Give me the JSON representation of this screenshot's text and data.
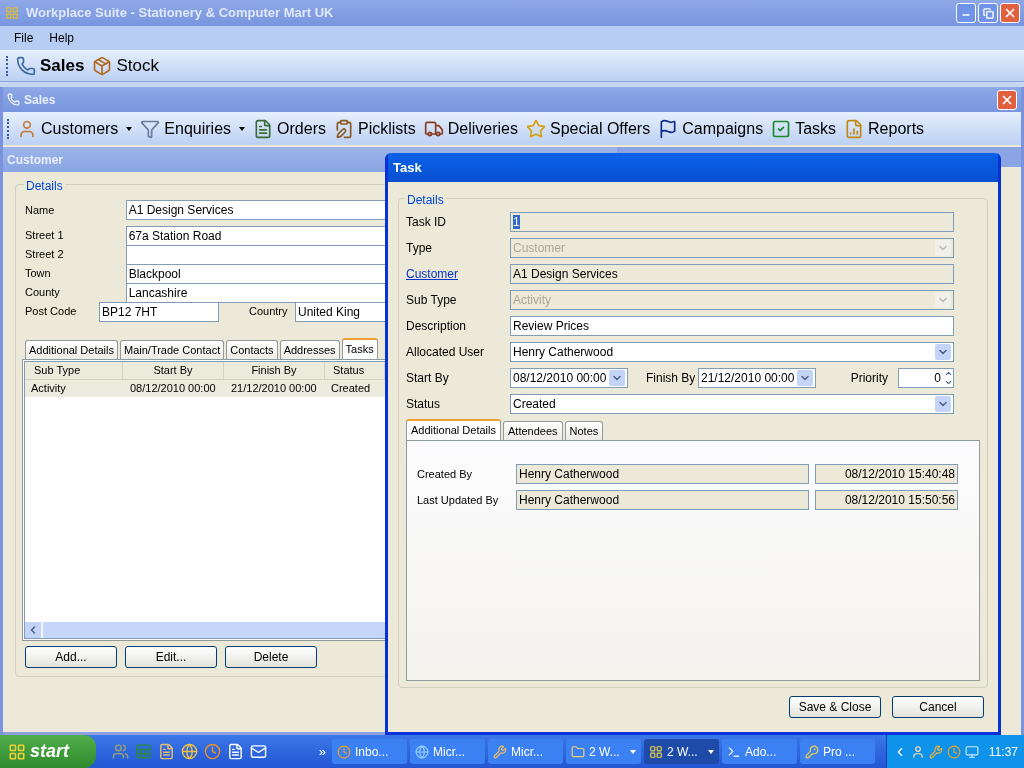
{
  "window": {
    "title": "Workplace Suite - Stationery & Computer Mart UK"
  },
  "menu": [
    {
      "label": "File"
    },
    {
      "label": "Help"
    }
  ],
  "modules": [
    {
      "label": "Sales",
      "selected": true
    },
    {
      "label": "Stock",
      "selected": false
    }
  ],
  "sales_window": {
    "title": "Sales",
    "toolbar": [
      {
        "label": "Customers",
        "dropdown": true
      },
      {
        "label": "Enquiries",
        "dropdown": true
      },
      {
        "label": "Orders",
        "dropdown": false
      },
      {
        "label": "Picklists",
        "dropdown": false
      },
      {
        "label": "Deliveries",
        "dropdown": false
      },
      {
        "label": "Special Offers",
        "dropdown": false
      },
      {
        "label": "Campaigns",
        "dropdown": false
      },
      {
        "label": "Tasks",
        "dropdown": false
      },
      {
        "label": "Reports",
        "dropdown": false
      }
    ]
  },
  "customer_window": {
    "title": "Customer",
    "group": "Details",
    "fields": [
      {
        "label": "Name",
        "value": "A1 Design Services"
      },
      {
        "label": "Street 1",
        "value": "67a Station Road"
      },
      {
        "label": "Street 2"
      },
      {
        "label": "Town",
        "value": "Blackpool"
      },
      {
        "label": "County",
        "value": "Lancashire"
      },
      {
        "label": "Post Code",
        "value": "BP12 7HT"
      }
    ],
    "country": {
      "label": "Country",
      "value": "United King"
    },
    "tabs": [
      {
        "label": "Additional Details",
        "selected": false
      },
      {
        "label": "Main/Trade Contact",
        "selected": false
      },
      {
        "label": "Contacts",
        "selected": false
      },
      {
        "label": "Addresses",
        "selected": false
      },
      {
        "label": "Tasks",
        "selected": true
      }
    ],
    "table": {
      "columns": [
        "Sub Type",
        "Start By",
        "Finish By",
        "Status"
      ],
      "rows": [
        {
          "cells": [
            "Activity",
            "08/12/2010 00:00",
            "21/12/2010 00:00",
            "Created"
          ],
          "selected": true
        }
      ]
    },
    "buttons": [
      "Add...",
      "Edit...",
      "Delete"
    ]
  },
  "task_dialog": {
    "title": "Task",
    "group": "Details",
    "fields": [
      {
        "kind": "text",
        "label": "Task ID",
        "link": false,
        "value": "1",
        "readonly": true,
        "highlighted": true
      },
      {
        "kind": "combo",
        "label": "Type",
        "value": "Customer",
        "disabled": true
      },
      {
        "kind": "text",
        "label": "Customer",
        "link": true,
        "value": "A1 Design Services",
        "readonly": true,
        "highlighted": false
      },
      {
        "kind": "combo",
        "label": "Sub Type",
        "value": "Activity",
        "disabled": true
      },
      {
        "kind": "text",
        "label": "Description",
        "link": false,
        "value": "Review Prices",
        "readonly": false,
        "highlighted": false
      },
      {
        "kind": "combo",
        "label": "Allocated User",
        "value": "Henry Catherwood",
        "disabled": false
      },
      {
        "kind": "schedule",
        "label": "Start By",
        "value": "08/12/2010 00:00",
        "finish_label": "Finish By",
        "finish_value": "21/12/2010 00:00",
        "priority_label": "Priority",
        "priority_value": "0"
      },
      {
        "kind": "combo",
        "label": "Status",
        "value": "Created",
        "disabled": false
      }
    ],
    "tabs": [
      {
        "label": "Additional Details",
        "selected": true
      },
      {
        "label": "Attendees",
        "selected": false
      },
      {
        "label": "Notes",
        "selected": false
      }
    ],
    "audit": [
      {
        "label": "Created By",
        "user": "Henry Catherwood",
        "time": "08/12/2010 15:40:48"
      },
      {
        "label": "Last Updated By",
        "user": "Henry Catherwood",
        "time": "08/12/2010 15:50:56"
      }
    ],
    "buttons": [
      "Save & Close",
      "Cancel"
    ]
  },
  "taskbar": {
    "start": "start",
    "more": "»",
    "tasks": [
      {
        "label": "Inbo...",
        "dropdown": false,
        "selected": false
      },
      {
        "label": "Micr...",
        "dropdown": false,
        "selected": false
      },
      {
        "label": "Micr...",
        "dropdown": false,
        "selected": false
      },
      {
        "label": "2 W...",
        "dropdown": true,
        "selected": false
      },
      {
        "label": "2 W...",
        "dropdown": true,
        "selected": true
      },
      {
        "label": "Ado...",
        "dropdown": false,
        "selected": false
      },
      {
        "label": "Pro ...",
        "dropdown": false,
        "selected": false
      }
    ],
    "clock": "11:37"
  }
}
